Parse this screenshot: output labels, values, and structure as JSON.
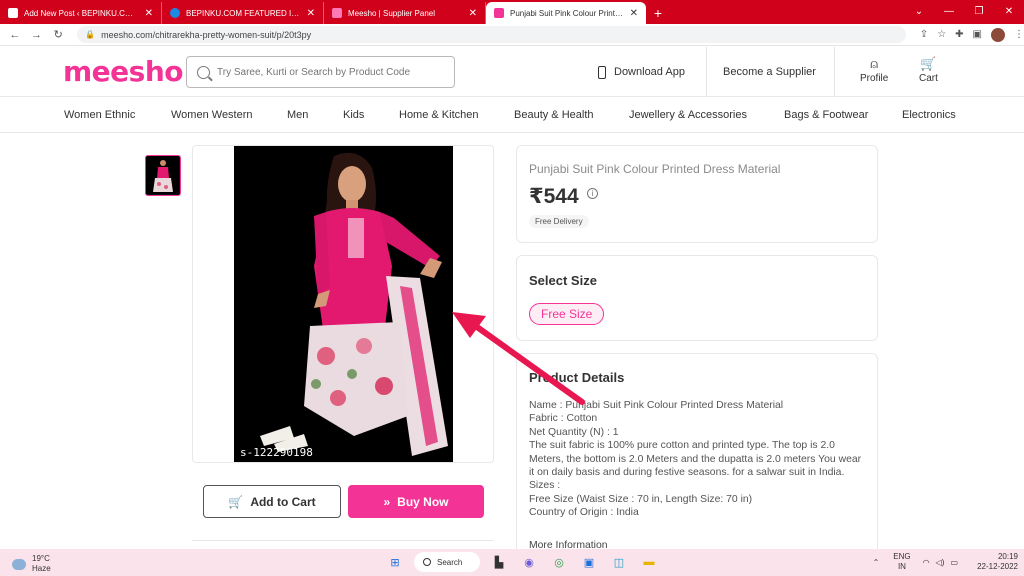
{
  "browser": {
    "tabs": [
      {
        "label": "Add New Post ‹ BEPINKU.COM — ",
        "color": "#d0021b"
      },
      {
        "label": "BEPINKU.COM FEATURED IMAGE",
        "color": "#1e88e5"
      },
      {
        "label": "Meesho | Supplier Panel",
        "color": "#f43397"
      },
      {
        "label": "Punjabi Suit Pink Colour Printed ",
        "color": "#f43397"
      }
    ],
    "url": "meesho.com/chitrarekha-pretty-women-suit/p/20t3py"
  },
  "header": {
    "logo": "meesho",
    "search_placeholder": "Try Saree, Kurti or Search by Product Code",
    "download_app": "Download App",
    "become_supplier": "Become a Supplier",
    "profile": "Profile",
    "cart": "Cart"
  },
  "categories": [
    "Women Ethnic",
    "Women Western",
    "Men",
    "Kids",
    "Home & Kitchen",
    "Beauty & Health",
    "Jewellery & Accessories",
    "Bags & Footwear",
    "Electronics"
  ],
  "product": {
    "image_code": "s-122290198",
    "title": "Punjabi Suit Pink Colour Printed Dress Material",
    "price": "₹544",
    "delivery": "Free Delivery",
    "add_to_cart": "Add to Cart",
    "buy_now": "Buy Now",
    "select_size_title": "Select Size",
    "size": "Free Size",
    "details_title": "Product Details",
    "details": [
      "Name : Punjabi Suit Pink Colour Printed Dress Material",
      "Fabric : Cotton",
      "Net Quantity (N) : 1",
      "The suit fabric is 100% pure cotton and printed type. The top is 2.0 Meters, the bottom is 2.0 Meters and the dupatta is 2.0 meters You wear it on daily basis and during festive seasons. for a salwar suit in India.",
      "Sizes :",
      "Free Size (Waist Size : 70 in, Length Size: 70 in)",
      "Country of Origin : India"
    ],
    "more_info": "More Information"
  },
  "taskbar": {
    "temp": "19°C",
    "weather": "Haze",
    "search": "Search",
    "lang1": "ENG",
    "lang2": "IN",
    "time": "20:19",
    "date": "22-12-2022"
  },
  "colors": {
    "brand": "#f43397",
    "tabbar": "#d0021b",
    "arrow": "#e8174f"
  }
}
